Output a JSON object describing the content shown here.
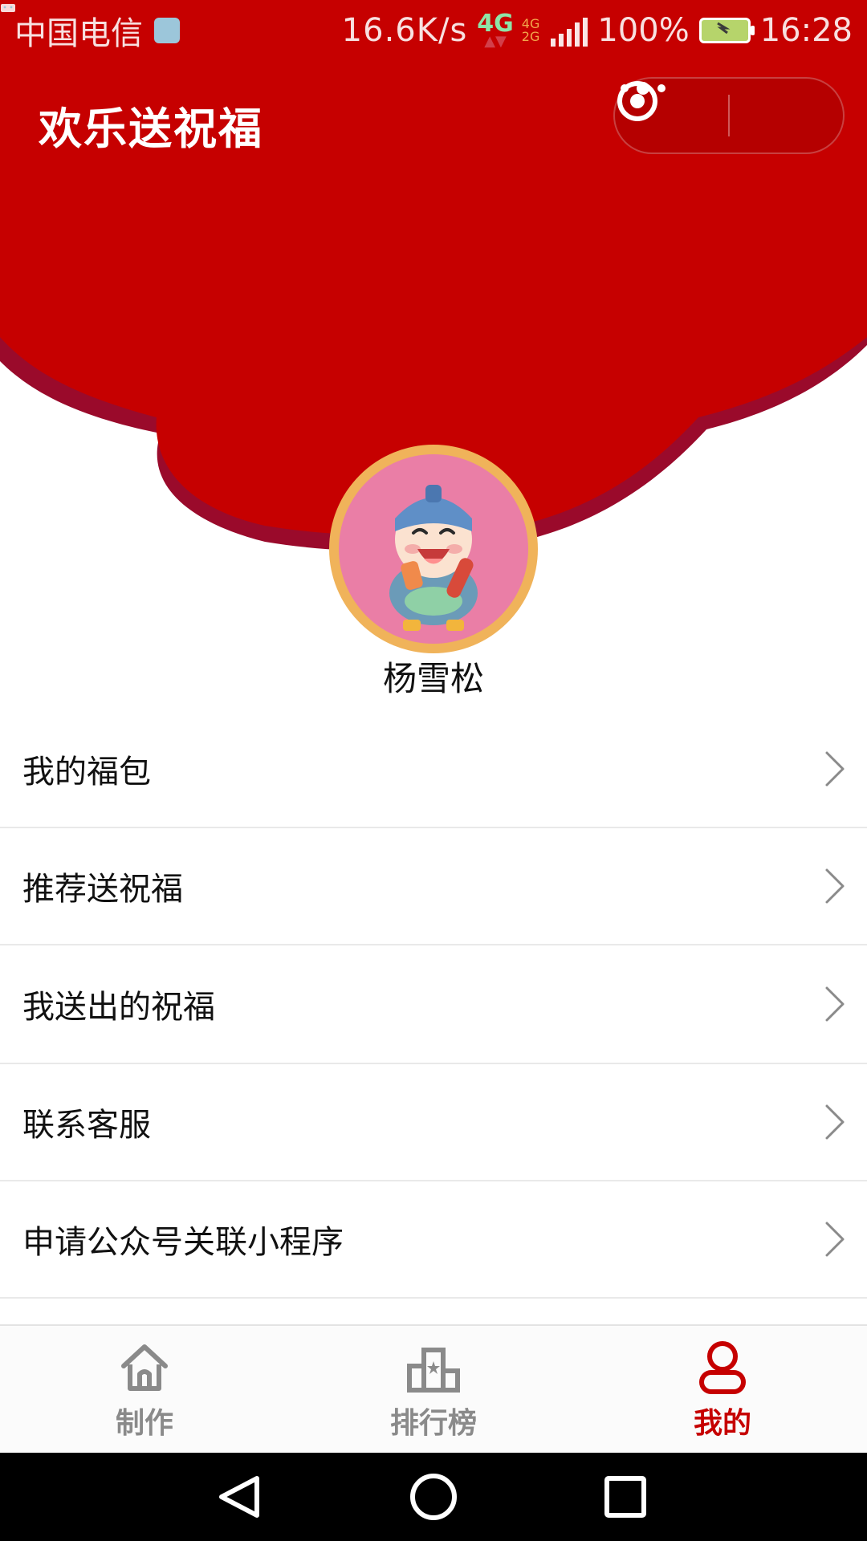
{
  "colors": {
    "primary_red": "#c60000",
    "dark_red_shadow": "#9a0a2b",
    "avatar_ring": "#f0b35a",
    "avatar_bg": "#ea7ea6"
  },
  "status_bar": {
    "carrier": "中国电信",
    "net_speed": "16.6K/s",
    "network_main": "4G",
    "network_small_top": "4G",
    "network_small_bottom": "2G",
    "battery": "100%",
    "time": "16:28"
  },
  "header": {
    "title": "欢乐送祝福",
    "menu_icon": "more-dots-icon",
    "close_icon": "target-circle-icon"
  },
  "profile": {
    "username": "杨雪松",
    "avatar_icon": "cartoon-fortune-god-avatar"
  },
  "menu": {
    "items": [
      {
        "label": "我的福包"
      },
      {
        "label": "推荐送祝福"
      },
      {
        "label": "我送出的祝福"
      },
      {
        "label": "联系客服"
      },
      {
        "label": "申请公众号关联小程序"
      }
    ]
  },
  "tabbar": {
    "tabs": [
      {
        "label": "制作",
        "icon": "home-icon",
        "active": false
      },
      {
        "label": "排行榜",
        "icon": "leaderboard-icon",
        "active": false
      },
      {
        "label": "我的",
        "icon": "user-icon",
        "active": true
      }
    ]
  },
  "system_nav": {
    "back": "back-triangle-icon",
    "home": "home-circle-icon",
    "recent": "recent-square-icon"
  }
}
